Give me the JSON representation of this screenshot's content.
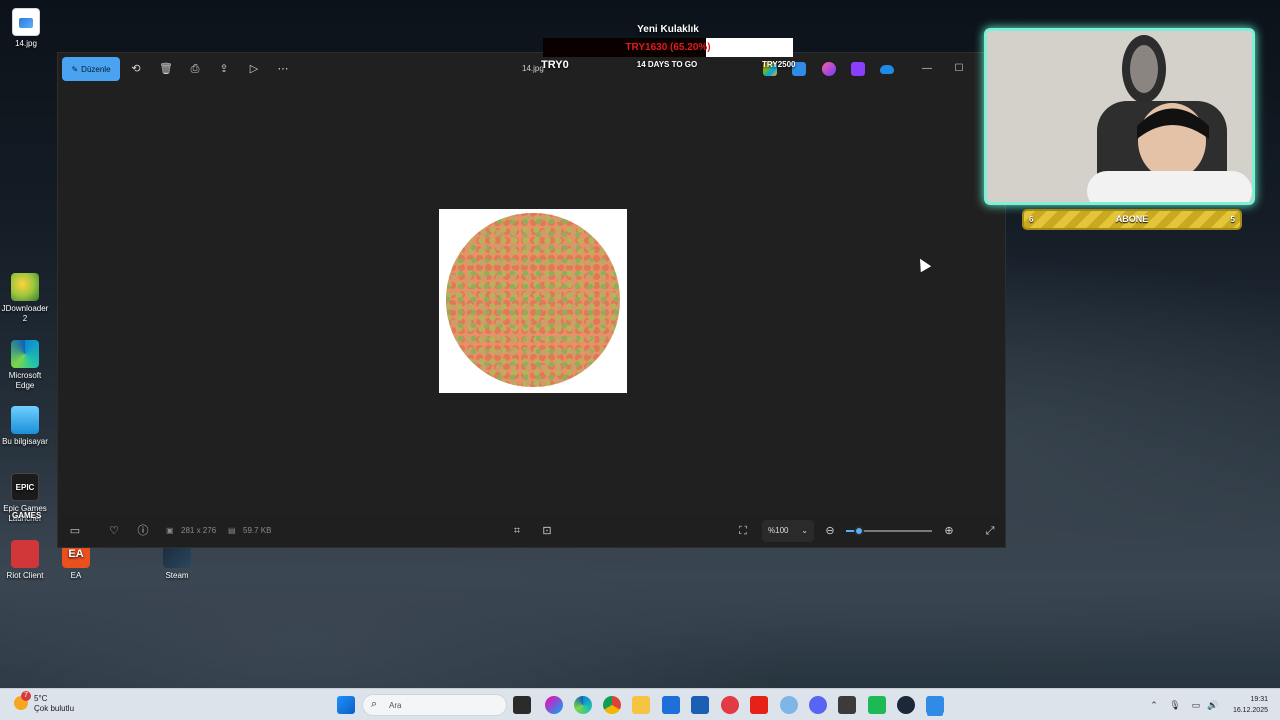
{
  "desktop": {
    "icons": [
      {
        "label": "14.jpg",
        "icon": "image-file-icon"
      },
      {
        "label": "JDownloader 2",
        "icon": "jdownloader-icon"
      },
      {
        "label": "Microsoft Edge",
        "icon": "edge-icon"
      },
      {
        "label": "Bu bilgisayar",
        "icon": "computer-icon"
      },
      {
        "label": "Epic Games Launcher",
        "icon": "epic-games-icon",
        "logo_text": "EPIC GAMES"
      },
      {
        "label": "Riot Client",
        "icon": "riot-client-icon"
      },
      {
        "label": "EA",
        "icon": "ea-icon",
        "logo_text": "EA"
      },
      {
        "label": "Steam",
        "icon": "steam-icon"
      }
    ]
  },
  "photos_app": {
    "edit_label": "Düzenle",
    "file_name": "14.jpg",
    "toolbar_icons": [
      "pencil-icon",
      "rotate-icon",
      "trash-icon",
      "print-icon",
      "share-icon",
      "slideshow-icon",
      "more-icon"
    ],
    "bottom": {
      "dimensions": "281 x 276",
      "file_size": "59.7 KB",
      "zoom": "%100",
      "zoom_level": 0.15
    }
  },
  "stream_overlay": {
    "goal_title": "Yeni Kulaklık",
    "goal_progress_text": "TRY1630 (65.20%)",
    "goal_progress": 0.652,
    "goal_start": "TRY0",
    "goal_days": "14 DAYS TO GO",
    "goal_target": "TRY2500",
    "sub_label": "ABONE",
    "sub_current": "6",
    "sub_target": "5"
  },
  "taskbar": {
    "weather_temp": "5°C",
    "weather_desc": "Çok bulutlu",
    "weather_badge": "7",
    "search_placeholder": "Ara",
    "time": "19:31",
    "date": "16.12.2025"
  },
  "colors": {
    "accent": "#4aa3f0",
    "goal_text": "#e21b1b",
    "webcam_border": "#7ef0d6",
    "sub_bar": "#e4c53a"
  }
}
